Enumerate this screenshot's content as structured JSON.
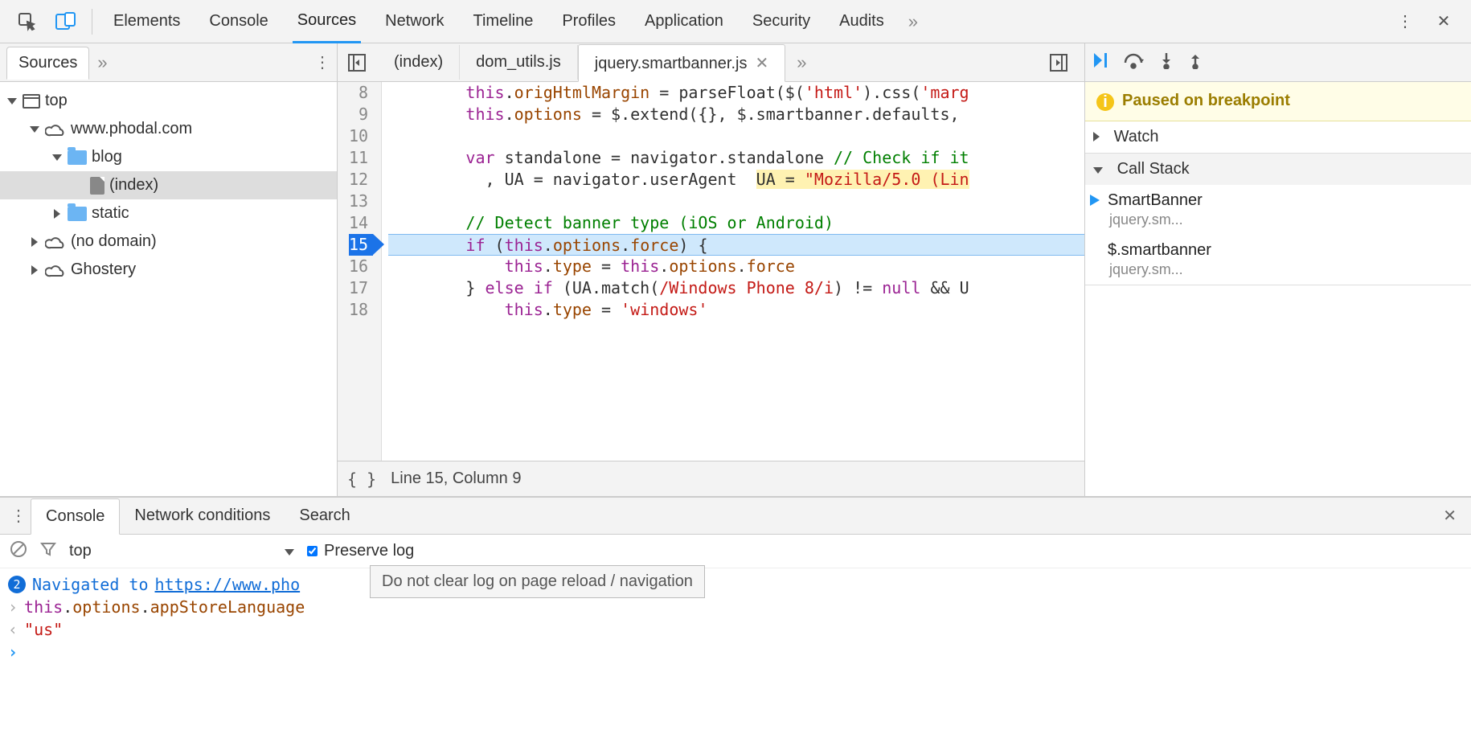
{
  "top_toolbar": {
    "tabs": [
      "Elements",
      "Console",
      "Sources",
      "Network",
      "Timeline",
      "Profiles",
      "Application",
      "Security",
      "Audits"
    ],
    "active_tab_index": 2
  },
  "left": {
    "header_tab": "Sources",
    "tree": [
      {
        "depth": 0,
        "expanded": true,
        "icon": "frame",
        "label": "top"
      },
      {
        "depth": 1,
        "expanded": true,
        "icon": "cloud",
        "label": "www.phodal.com"
      },
      {
        "depth": 2,
        "expanded": true,
        "icon": "folder",
        "label": "blog"
      },
      {
        "depth": 3,
        "expanded": null,
        "icon": "file",
        "label": "(index)",
        "selected": true
      },
      {
        "depth": 2,
        "expanded": false,
        "icon": "folder",
        "label": "static"
      },
      {
        "depth": 1,
        "expanded": false,
        "icon": "cloud",
        "label": "(no domain)"
      },
      {
        "depth": 1,
        "expanded": false,
        "icon": "cloud",
        "label": "Ghostery"
      }
    ]
  },
  "files": {
    "tabs": [
      "(index)",
      "dom_utils.js",
      "jquery.smartbanner.js"
    ],
    "active_index": 2,
    "cursor_status": "Line 15, Column 9",
    "exec_line": 15,
    "first_line": 8,
    "inline_annotation": "UA = \"Mozilla/5.0 (Lin",
    "code_lines": [
      {
        "n": 8,
        "html": "        <span class='kw'>this</span>.<span class='prop'>origHtmlMargin</span> = parseFloat($(<span class='str'>'html'</span>).css(<span class='str'>'marg"
      },
      {
        "n": 9,
        "html": "        <span class='kw'>this</span>.<span class='prop'>options</span> = $.extend({}, $.smartbanner.defaults, "
      },
      {
        "n": 10,
        "html": ""
      },
      {
        "n": 11,
        "html": "        <span class='kw'>var</span> standalone = navigator.standalone <span class='cmt'>// Check if it</span>"
      },
      {
        "n": 12,
        "html": "          , UA = navigator.userAgent  <span class='ann-bg'>UA = <span class='str'>\"Mozilla/5.0 (Lin</span></span>"
      },
      {
        "n": 13,
        "html": ""
      },
      {
        "n": 14,
        "html": "        <span class='cmt'>// Detect banner type (iOS or Android)</span>"
      },
      {
        "n": 15,
        "html": "        <span class='kw'>if</span> (<span class='kw'>this</span>.<span class='prop'>options</span>.<span class='prop'>force</span>) {",
        "exec": true
      },
      {
        "n": 16,
        "html": "            <span class='kw'>this</span>.<span class='prop'>type</span> = <span class='kw'>this</span>.<span class='prop'>options</span>.<span class='prop'>force</span>"
      },
      {
        "n": 17,
        "html": "        } <span class='kw'>else if</span> (UA.match(<span class='rgx'>/Windows Phone 8/i</span>) != <span class='kw'>null</span> && U"
      },
      {
        "n": 18,
        "html": "            <span class='kw'>this</span>.<span class='prop'>type</span> = <span class='str'>'windows'</span>"
      }
    ]
  },
  "debugger": {
    "banner": "Paused on breakpoint",
    "sections": {
      "watch": "Watch",
      "callstack": "Call Stack"
    },
    "callstack": [
      {
        "fn": "SmartBanner",
        "loc": "jquery.sm...",
        "current": true
      },
      {
        "fn": "$.smartbanner",
        "loc": "jquery.sm...",
        "current": false
      }
    ]
  },
  "drawer": {
    "tabs": [
      "Console",
      "Network conditions",
      "Search"
    ],
    "active_index": 0,
    "context": "top",
    "preserve_log_label": "Preserve log",
    "preserve_log_checked": true,
    "tooltip": "Do not clear log on page reload / navigation",
    "nav_count": "2",
    "nav_prefix": "Navigated to ",
    "nav_url": "https://www.pho",
    "eval_input": "this.options.appStoreLanguage",
    "eval_output": "\"us\""
  }
}
